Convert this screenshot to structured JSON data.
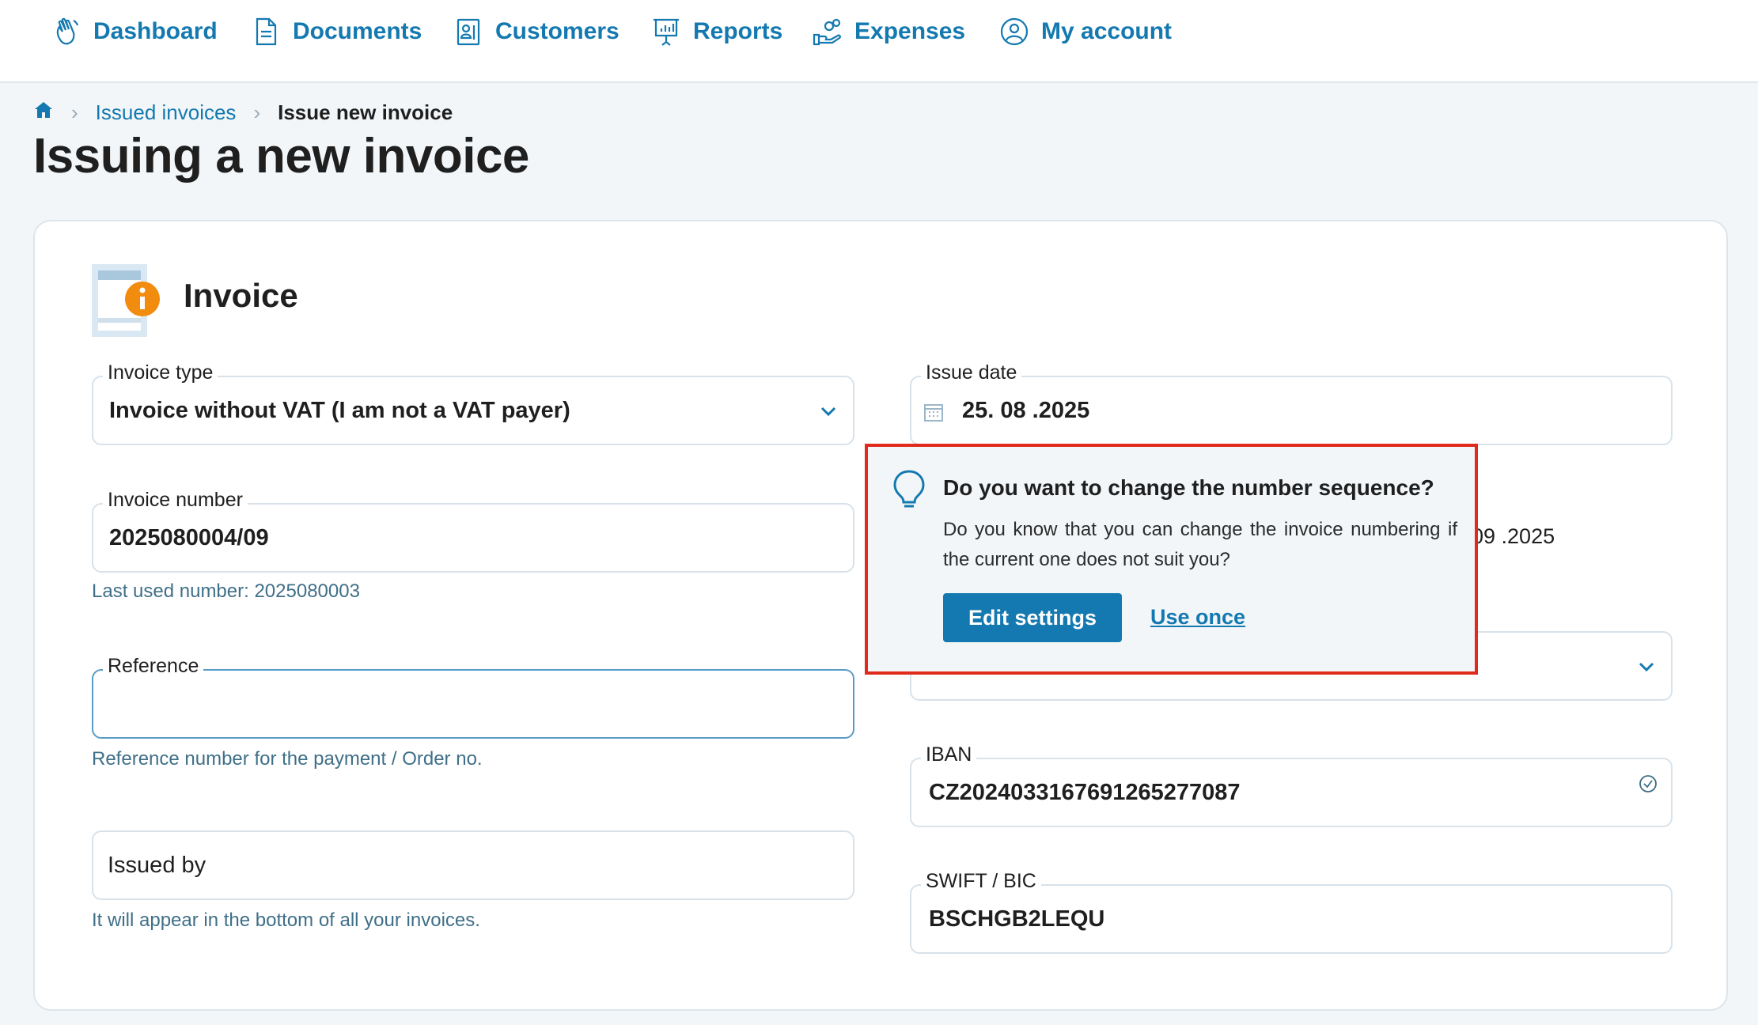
{
  "nav": {
    "items": [
      {
        "label": "Dashboard",
        "icon": "hand-wave-icon"
      },
      {
        "label": "Documents",
        "icon": "document-icon"
      },
      {
        "label": "Customers",
        "icon": "contact-card-icon"
      },
      {
        "label": "Reports",
        "icon": "presentation-chart-icon"
      },
      {
        "label": "Expenses",
        "icon": "hand-coins-icon"
      },
      {
        "label": "My account",
        "icon": "user-circle-icon"
      }
    ]
  },
  "breadcrumb": {
    "home_icon": "home-icon",
    "link": "Issued invoices",
    "current": "Issue new invoice"
  },
  "page": {
    "title": "Issuing a new invoice"
  },
  "card": {
    "title": "Invoice",
    "icon": "invoice-info-icon",
    "invoice_type": {
      "label": "Invoice type",
      "value": "Invoice without VAT (I am not a VAT payer)"
    },
    "invoice_number": {
      "label": "Invoice number",
      "value": "2025080004/09",
      "helper": "Last used number: 2025080003"
    },
    "reference": {
      "label": "Reference",
      "value": "",
      "helper": "Reference number for the payment / Order no."
    },
    "issued_by": {
      "placeholder": "Issued by",
      "helper": "It will appear in the bottom of all your invoices."
    },
    "issue_date": {
      "label": "Issue date",
      "value": "25. 08 .2025"
    },
    "partially_hidden_date": "09 .2025",
    "iban": {
      "label": "IBAN",
      "value": "CZ2024033167691265277087"
    },
    "swift": {
      "label": "SWIFT / BIC",
      "value": "BSCHGB2LEQU"
    }
  },
  "popover": {
    "title": "Do you want to change the number sequence?",
    "text": "Do you know that you can change the invoice numbering if the current one does not suit you?",
    "primary_label": "Edit settings",
    "secondary_label": "Use once"
  },
  "colors": {
    "accent": "#1479b0",
    "highlight_border": "#e02a1c",
    "invoice_icon_badge": "#f28c0f"
  }
}
